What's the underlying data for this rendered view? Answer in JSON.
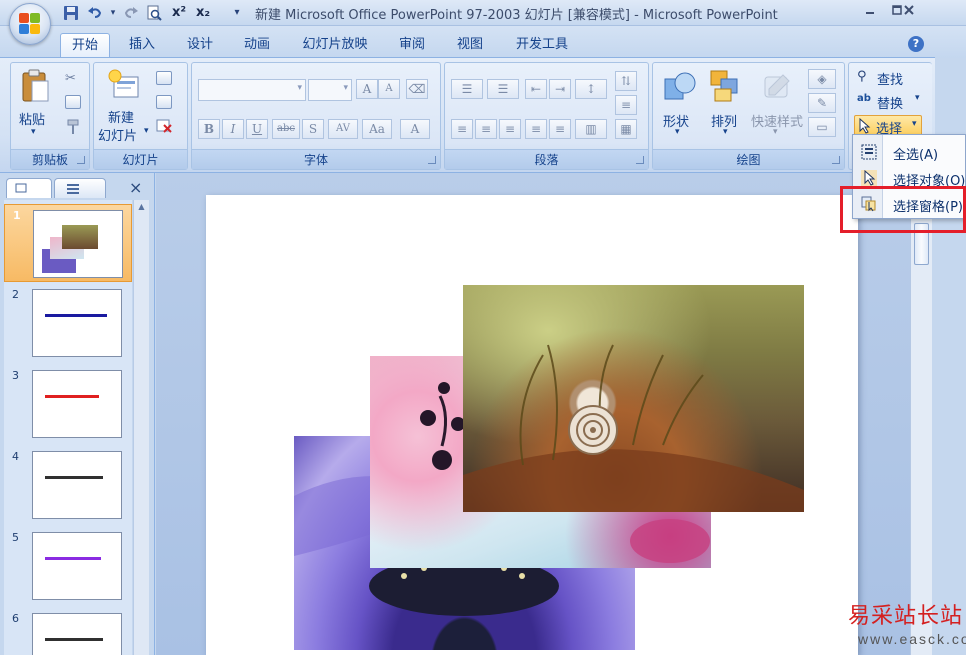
{
  "window": {
    "title": "新建 Microsoft Office PowerPoint 97-2003 幻灯片 [兼容模式] - Microsoft PowerPoint",
    "minimize_icon": "minimize-icon",
    "maximize_icon": "maximize-icon",
    "close_icon": "close-icon"
  },
  "quick_access": [
    "save-icon",
    "undo-icon",
    "redo-icon",
    "print-preview-icon",
    "superscript-icon",
    "subscript-icon",
    "customize-icon"
  ],
  "quick_access_labels": {
    "superscript": "x²",
    "subscript": "x₂"
  },
  "tabs": [
    {
      "label": "开始",
      "active": true
    },
    {
      "label": "插入"
    },
    {
      "label": "设计"
    },
    {
      "label": "动画"
    },
    {
      "label": "幻灯片放映"
    },
    {
      "label": "审阅"
    },
    {
      "label": "视图"
    },
    {
      "label": "开发工具"
    }
  ],
  "ribbon": {
    "clipboard": {
      "label": "剪贴板",
      "paste": "粘贴"
    },
    "slides": {
      "label": "幻灯片",
      "new_slide_line1": "新建",
      "new_slide_line2": "幻灯片"
    },
    "font": {
      "label": "字体",
      "bold": "B",
      "italic": "I",
      "underline": "U",
      "strikethrough": "abc",
      "shadow": "S",
      "spacing": "AV",
      "case": "Aa",
      "grow": "A",
      "shrink": "A",
      "color": "A"
    },
    "paragraph": {
      "label": "段落"
    },
    "drawing": {
      "label": "绘图",
      "shapes": "形状",
      "arrange": "排列",
      "quick_styles": "快速样式"
    },
    "editing": {
      "find": "查找",
      "replace": "替换",
      "select": "选择"
    }
  },
  "select_menu": {
    "items": [
      {
        "label": "全选(A)",
        "icon": "select-all-icon"
      },
      {
        "label": "选择对象(O)",
        "icon": "select-objects-cursor-icon"
      },
      {
        "label": "选择窗格(P)...",
        "icon": "selection-pane-icon",
        "highlighted": true
      }
    ]
  },
  "slides_panel": {
    "tabs": [
      "slides-tab-icon",
      "outline-tab-icon"
    ],
    "close_label": "×",
    "thumbnails": [
      {
        "number": "1",
        "selected": true,
        "text": "",
        "text_color": ""
      },
      {
        "number": "2",
        "text": " ",
        "text_color": "#1a1aa0"
      },
      {
        "number": "3",
        "text": " ",
        "text_color": "#e02020"
      },
      {
        "number": "4",
        "text": " ",
        "text_color": "#202020"
      },
      {
        "number": "5",
        "text": " ",
        "text_color": "#8a2be2"
      },
      {
        "number": "6",
        "text": " ",
        "text_color": "#202020"
      }
    ]
  },
  "slide_images": [
    {
      "description": "purple-flower-photo"
    },
    {
      "description": "pink-flower-photo"
    },
    {
      "description": "snail-shell-on-rock-photo"
    }
  ],
  "watermark": {
    "text": "易采站长站",
    "url": "www.easck.com"
  },
  "colors": {
    "highlight_box": "#e41e2a",
    "ribbon": "#dbe6f6",
    "selected_thumb": "#f7ba64"
  }
}
